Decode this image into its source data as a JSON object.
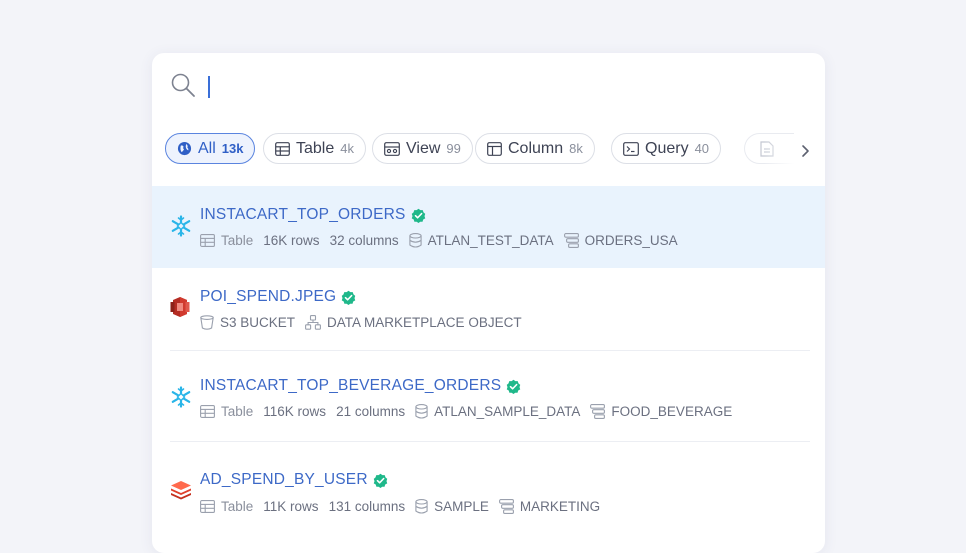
{
  "search": {
    "value": ""
  },
  "filters": [
    {
      "label": "All",
      "count": "13k",
      "icon": "globe-icon",
      "active": true
    },
    {
      "label": "Table",
      "count": "4k",
      "icon": "table-icon"
    },
    {
      "label": "View",
      "count": "99",
      "icon": "view-icon"
    },
    {
      "label": "Column",
      "count": "8k",
      "icon": "column-icon"
    },
    {
      "label": "Query",
      "count": "40",
      "icon": "terminal-icon"
    }
  ],
  "results": [
    {
      "title": "INSTACART_TOP_ORDERS",
      "source_icon": "snowflake-icon",
      "verified": true,
      "type": "Table",
      "rows": "16K rows",
      "columns": "32 columns",
      "database": "ATLAN_TEST_DATA",
      "schema": "ORDERS_USA"
    },
    {
      "title": "POI_SPEND.JPEG",
      "source_icon": "s3-icon",
      "verified": true,
      "type": "S3 BUCKET",
      "object": "DATA MARKETPLACE OBJECT"
    },
    {
      "title": "INSTACART_TOP_BEVERAGE_ORDERS",
      "source_icon": "snowflake-icon",
      "verified": true,
      "type": "Table",
      "rows": "116K rows",
      "columns": "21 columns",
      "database": "ATLAN_SAMPLE_DATA",
      "schema": "FOOD_BEVERAGE"
    },
    {
      "title": "AD_SPEND_BY_USER",
      "source_icon": "databricks-icon",
      "verified": true,
      "type": "Table",
      "rows": "11K rows",
      "columns": "131 columns",
      "database": "SAMPLE",
      "schema": "MARKETING"
    }
  ],
  "colors": {
    "accent": "#3d69c7",
    "selected_row": "#e9f3fd",
    "verified": "#1fb88a",
    "snowflake": "#29b5e8",
    "s3": "#d13a2e",
    "databricks": "#e0402c"
  }
}
